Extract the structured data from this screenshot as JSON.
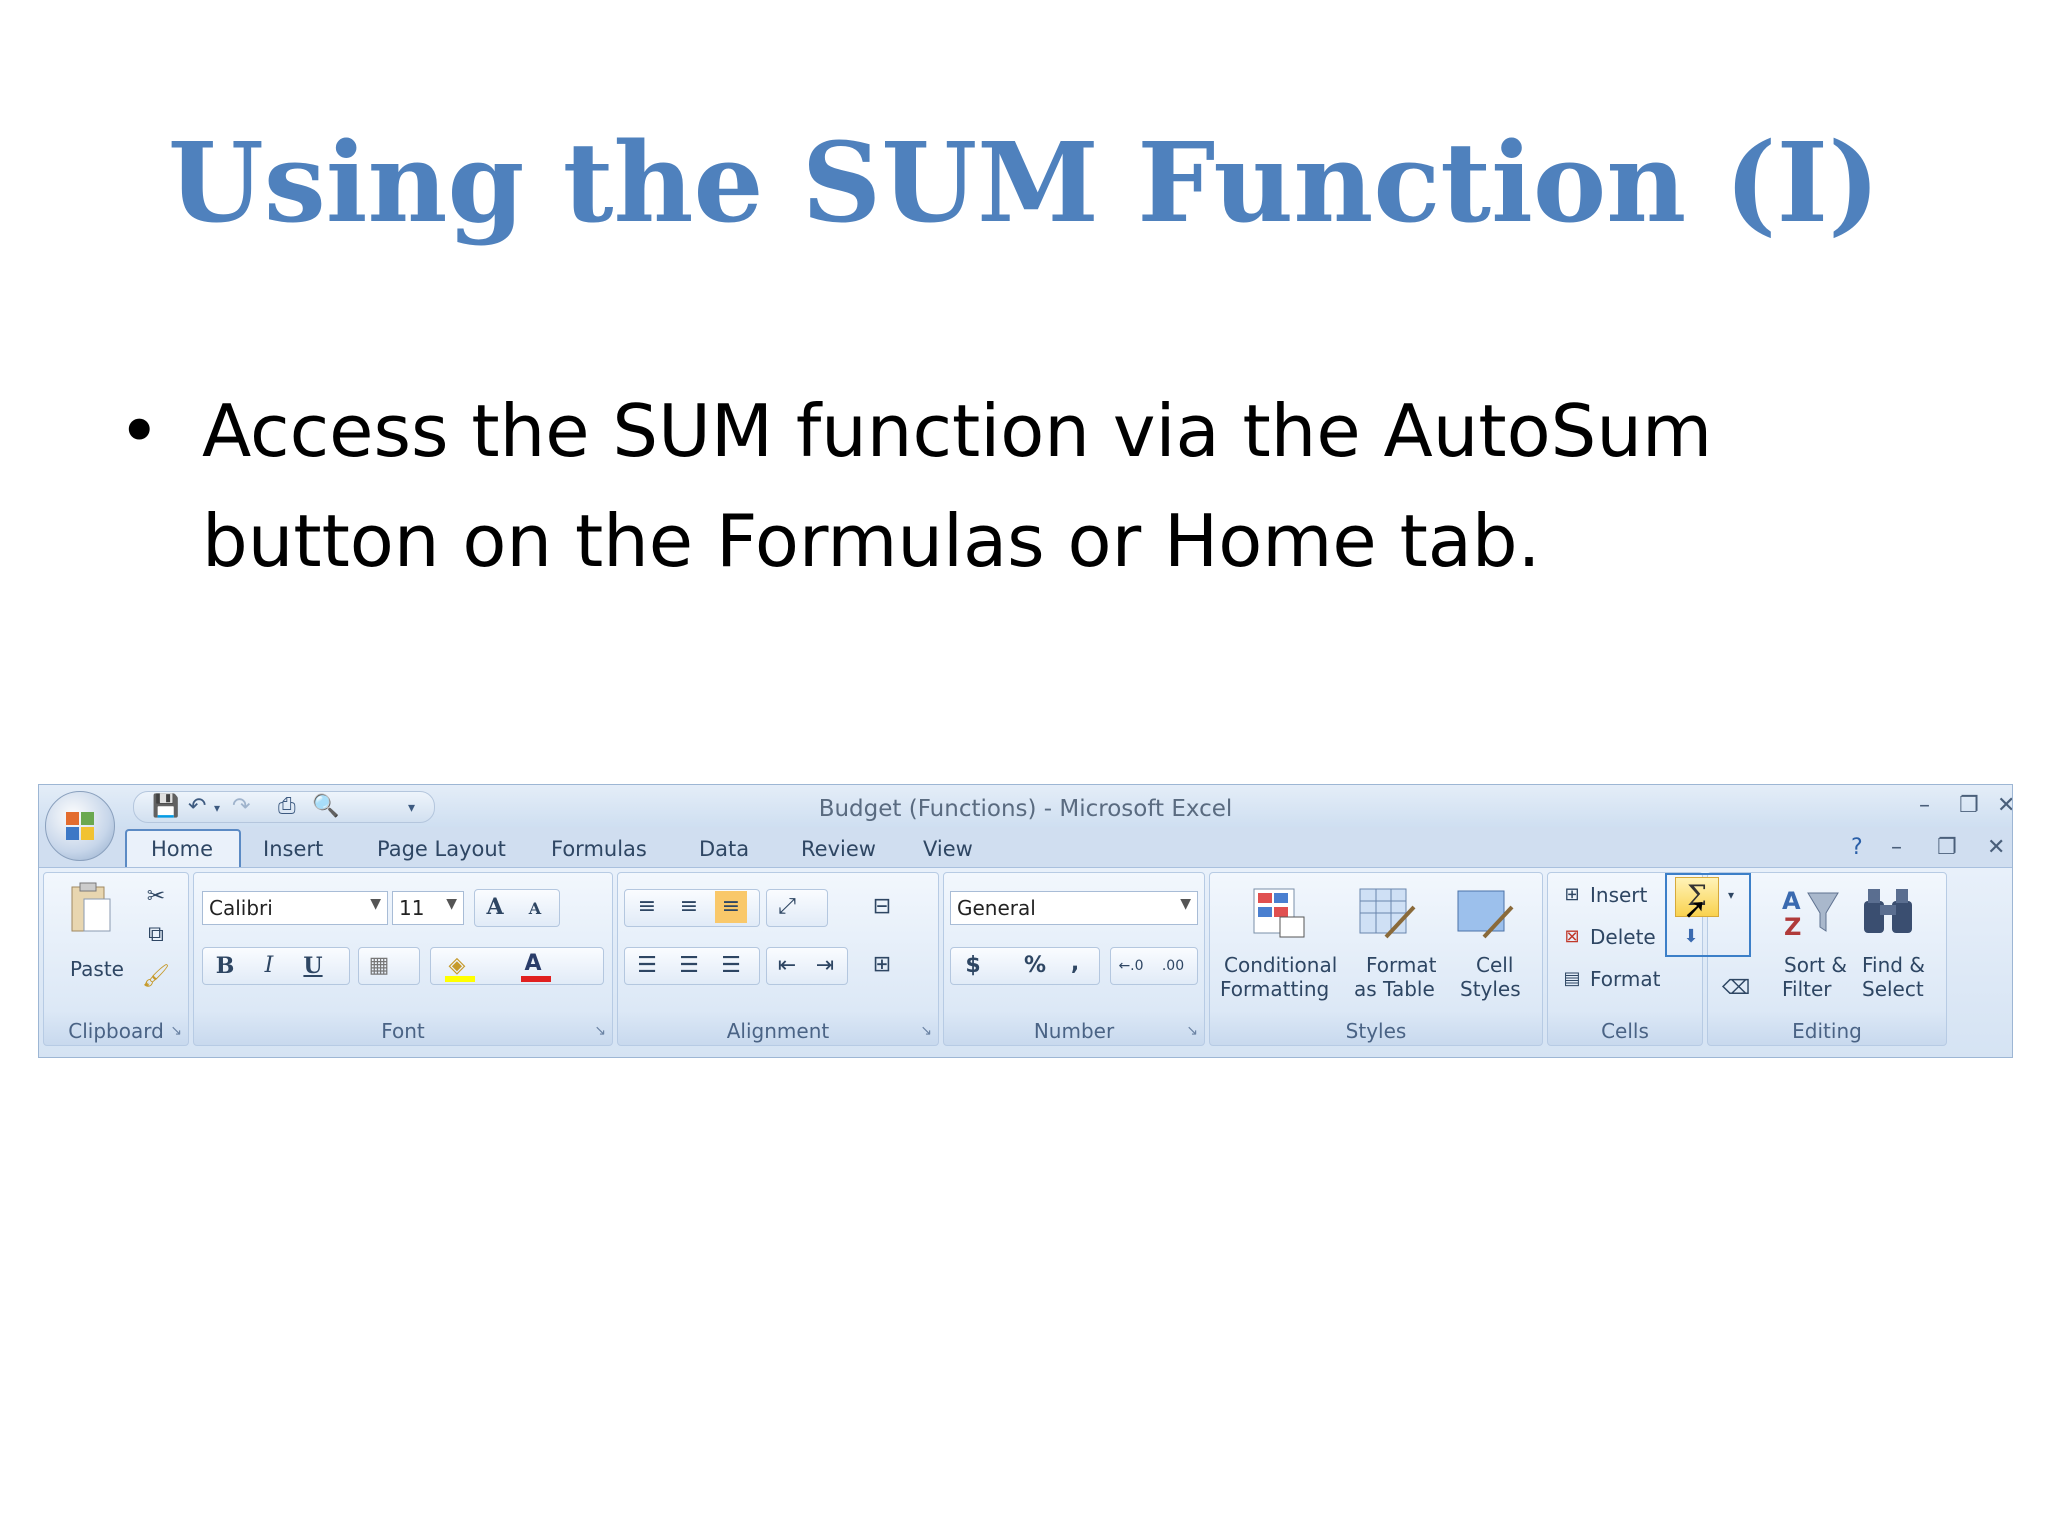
{
  "slide": {
    "title": "Using the SUM Function (I)",
    "bullet": "Access the SUM function via the AutoSum button on the Formulas or Home tab."
  },
  "excel": {
    "window_title": "Budget (Functions) - Microsoft Excel",
    "tabs": [
      "Home",
      "Insert",
      "Page Layout",
      "Formulas",
      "Data",
      "Review",
      "View"
    ],
    "active_tab": "Home",
    "groups": {
      "clipboard": {
        "label": "Clipboard",
        "paste": "Paste"
      },
      "font": {
        "label": "Font",
        "font_name": "Calibri",
        "font_size": "11",
        "bold": "B",
        "italic": "I",
        "underline": "U",
        "grow": "A",
        "shrink": "A"
      },
      "alignment": {
        "label": "Alignment"
      },
      "number": {
        "label": "Number",
        "format": "General",
        "currency": "$",
        "percent": "%",
        "comma": ","
      },
      "styles": {
        "label": "Styles",
        "conditional_1": "Conditional",
        "conditional_2": "Formatting",
        "format_table_1": "Format",
        "format_table_2": "as Table",
        "cell_styles_1": "Cell",
        "cell_styles_2": "Styles"
      },
      "cells": {
        "label": "Cells",
        "insert": "Insert",
        "delete": "Delete",
        "format": "Format"
      },
      "editing": {
        "label": "Editing",
        "sort_1": "Sort &",
        "sort_2": "Filter",
        "find_1": "Find &",
        "find_2": "Select",
        "autosum_symbol": "Σ"
      }
    },
    "colors": {
      "title_blue": "#4f81bd",
      "ribbon": "#d5e3f3",
      "highlight": "#3c7fc8"
    }
  }
}
